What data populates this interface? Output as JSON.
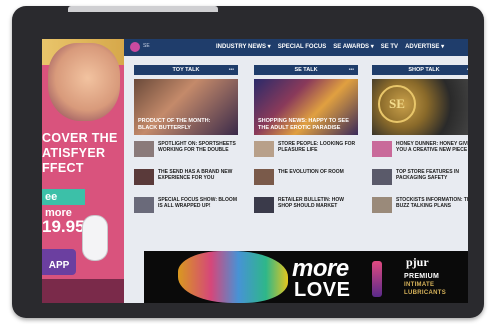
{
  "side_ad": {
    "line1": "COVER THE",
    "line2": "ATISFYER",
    "line3": "FFECT",
    "cta": "ee more",
    "price": "19.95",
    "app_badge": "APP"
  },
  "nav": {
    "logo_text": "SE",
    "items": [
      "INDUSTRY NEWS ▾",
      "SPECIAL FOCUS",
      "SE AWARDS ▾",
      "SE TV",
      "ADVERTISE ▾"
    ]
  },
  "columns": [
    {
      "heading": "TOY TALK",
      "more": "•••",
      "hero_caption": "PRODUCT OF THE MONTH: BLACK BUTTERFLY",
      "items": [
        {
          "title": "SPOTLIGHT ON: SPORTSHEETS WORKING FOR THE DOUBLE"
        },
        {
          "title": "THE SEND HAS A BRAND NEW EXPERIENCE FOR YOU"
        },
        {
          "title": "SPECIAL FOCUS SHOW: BLOOM IS ALL WRAPPED UP!"
        }
      ]
    },
    {
      "heading": "SE TALK",
      "more": "•••",
      "hero_caption": "SHOPPING NEWS: HAPPY TO SEE THE ADULT EROTIC PARADISE",
      "items": [
        {
          "title": "STORE PEOPLE: LOOKING FOR PLEASURE LIFE"
        },
        {
          "title": "THE EVOLUTION OF ROOM"
        },
        {
          "title": "RETAILER BULLETIN: HOW SHOP SHOULD MARKET"
        }
      ]
    },
    {
      "heading": "SHOP TALK",
      "more": "•••",
      "hero_caption": "",
      "seal": "SE",
      "items": [
        {
          "title": "HONEY DUNNER: HONEY GIVES YOU A CREATIVE NEW PIECE"
        },
        {
          "title": "TOP STORE FEATURES IN PACKAGING SAFETY"
        },
        {
          "title": "STOCKISTS INFORMATION: THE BUZZ TALKING PLANS"
        }
      ]
    }
  ],
  "bottom_ad": {
    "headline1": "more",
    "headline2": "LOVE",
    "brand": "pjur",
    "sub1": "PREMIUM",
    "sub2": "INTIMATE",
    "sub3": "LUBRICANTS"
  },
  "colors": {
    "nav": "#1f3d6b",
    "side_ad": "#d9537d",
    "bezel": "#2a2a2e"
  }
}
